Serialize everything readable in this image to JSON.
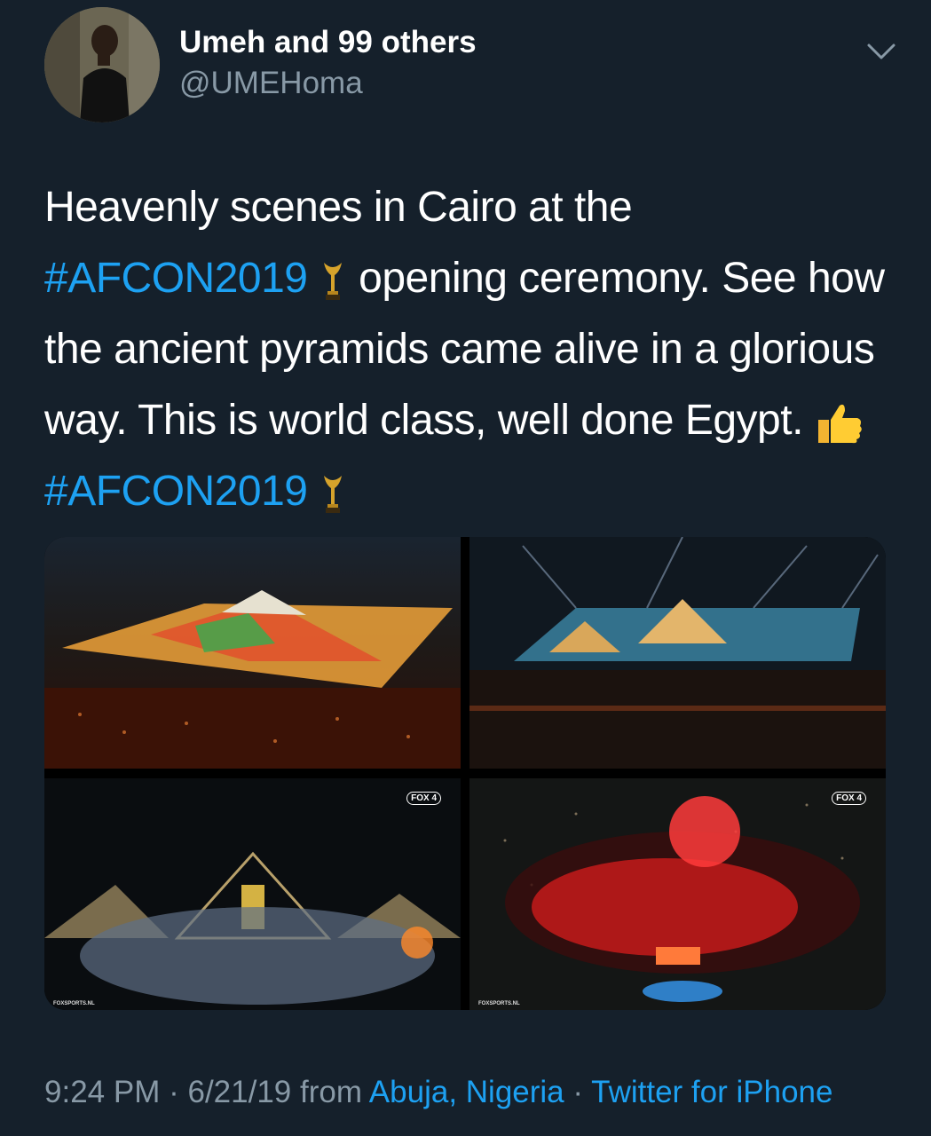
{
  "author": {
    "display_name": "Umeh and 99 others",
    "handle": "@UMEHoma"
  },
  "tweet": {
    "text_1": "Heavenly scenes in Cairo at the",
    "hashtag_1": "#AFCON2019",
    "text_2": " opening ceremony. See how the ancient pyramids came alive in a glorious way. This is world class, well done Egypt.",
    "hashtag_2": "#AFCON2019",
    "emojis": [
      "trophy-icon",
      "thumbs-up-icon",
      "trophy-icon"
    ]
  },
  "media": {
    "overlay_logo": "FOX",
    "overlay_channel": "4",
    "watermark": "FOXSPORTS.NL"
  },
  "meta": {
    "time": "9:24 PM",
    "separator": "·",
    "date": "6/21/19",
    "from": "from",
    "location": "Abuja, Nigeria",
    "source": "Twitter for iPhone"
  },
  "colors": {
    "background": "#15202b",
    "link": "#1da1f2",
    "secondary_text": "#8899a6"
  }
}
